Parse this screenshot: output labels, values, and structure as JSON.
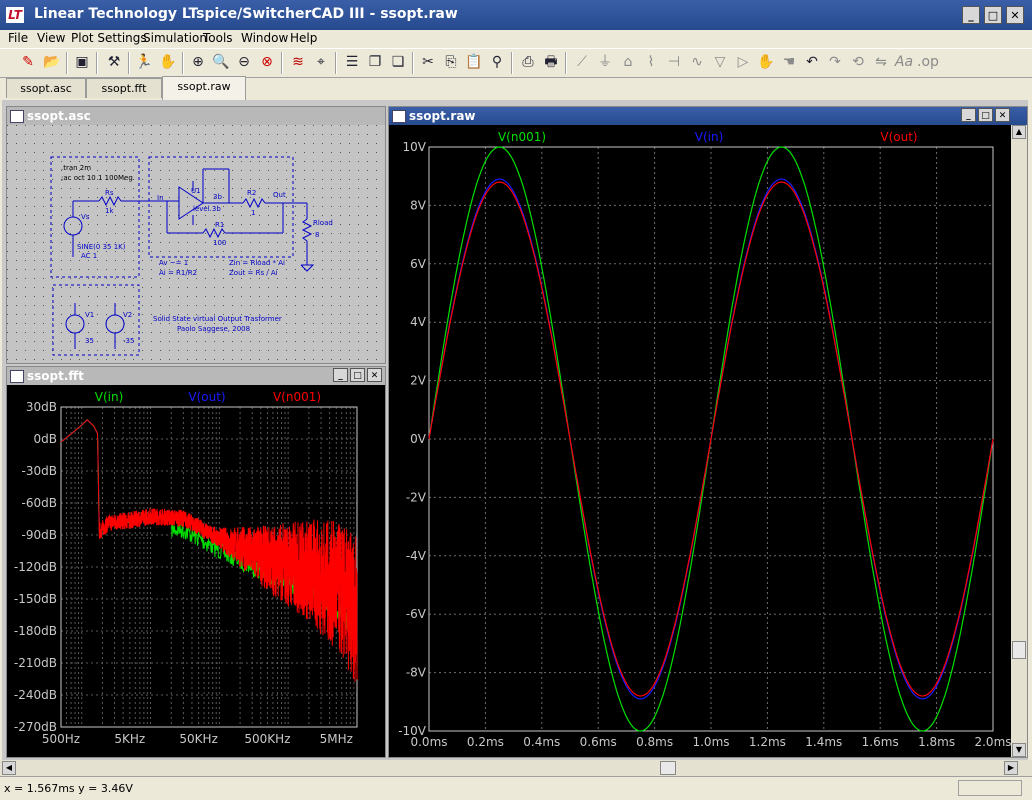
{
  "window": {
    "title": "Linear Technology LTspice/SwitcherCAD III - ssopt.raw",
    "icon_text": "LT"
  },
  "menu": [
    "File",
    "View",
    "Plot Settings",
    "Simulation",
    "Tools",
    "Window",
    "Help"
  ],
  "toolbar_icons": [
    "new-schematic-icon",
    "open-icon",
    "save-icon",
    "control-panel-icon",
    "run-icon",
    "pan-icon",
    "zoom-in-icon",
    "zoom-in-2-icon",
    "zoom-out-icon",
    "zoom-cancel-icon",
    "autoscale-icon",
    "cursor-icon",
    "tile-horizontal-icon",
    "cascade-icon",
    "tile-vertical-icon",
    "cut-icon",
    "copy-icon",
    "paste-icon",
    "find-icon",
    "print-setup-icon",
    "print-icon",
    "wire-icon",
    "ground-icon",
    "label-icon",
    "resistor-icon",
    "capacitor-icon",
    "inductor-icon",
    "diode-icon",
    "component-icon",
    "move-icon",
    "drag-icon",
    "undo-icon",
    "redo-icon",
    "rotate-icon",
    "mirror-icon",
    "text-icon",
    "spice-directive-icon"
  ],
  "tabs": [
    {
      "label": "ssopt.asc",
      "active": false
    },
    {
      "label": "ssopt.fft",
      "active": false
    },
    {
      "label": "ssopt.raw",
      "active": true
    }
  ],
  "schematic": {
    "title": "ssopt.asc",
    "directives": [
      ".tran 2m",
      ";ac oct 10 1 100Meg"
    ],
    "labels": {
      "rs": "Rs",
      "rs_val": "1k",
      "vs": "Vs",
      "sine": "SINE(0 35 1K)",
      "ac": "AC 1",
      "u1": "U1",
      "level": "level.3b",
      "u1_pin": "3b",
      "plus": "+",
      "minus": "-",
      "r2": "R2",
      "r2_val": "1",
      "out": "Out",
      "r1": "R1",
      "r1_val": "100",
      "rload": "Rload",
      "rload_val": "8",
      "in": "In",
      "av": "Av ~= 1",
      "ai": "Ai = R1/R2",
      "zin": "Zin = Rload * Ai",
      "zout": "Zout = Rs / Ai",
      "v1": "V1",
      "v1_val": "35",
      "v2": "V2",
      "v2_val": "-35",
      "caption": "Solid State virtual Output Trasformer",
      "author": "Paolo Saggese, 2008"
    }
  },
  "fft": {
    "title": "ssopt.fft",
    "chart_data": {
      "type": "line",
      "x_scale": "log",
      "x_ticks": [
        "500Hz",
        "5KHz",
        "50KHz",
        "500KHz",
        "5MHz"
      ],
      "y_ticks": [
        "30dB",
        "0dB",
        "-30dB",
        "-60dB",
        "-90dB",
        "-120dB",
        "-150dB",
        "-180dB",
        "-210dB",
        "-240dB",
        "-270dB"
      ],
      "ylim": [
        -270,
        30
      ],
      "xlim": [
        500,
        10000000
      ],
      "series": [
        {
          "name": "V(in)",
          "color": "#00e000"
        },
        {
          "name": "V(out)",
          "color": "#1a1aff"
        },
        {
          "name": "V(n001)",
          "color": "#ff0000"
        }
      ],
      "envelope": [
        [
          500,
          -3
        ],
        [
          1000,
          13
        ],
        [
          1200,
          18
        ],
        [
          1500,
          12
        ],
        [
          1700,
          5
        ],
        [
          1800,
          -88
        ],
        [
          2500,
          -80
        ],
        [
          5000,
          -78
        ],
        [
          10000,
          -74
        ],
        [
          30000,
          -76
        ],
        [
          100000,
          -95
        ],
        [
          500000,
          -118
        ],
        [
          2000000,
          -133
        ],
        [
          5000000,
          -150
        ],
        [
          10000000,
          -175
        ]
      ],
      "blue_tail": [
        [
          200000,
          -110
        ],
        [
          500000,
          -116
        ],
        [
          1000000,
          -119
        ],
        [
          3000000,
          -128
        ],
        [
          10000000,
          -143
        ]
      ],
      "background": "#000000",
      "grid": true
    }
  },
  "raw": {
    "title": "ssopt.raw",
    "chart_data": {
      "type": "line",
      "x_ticks": [
        "0.0ms",
        "0.2ms",
        "0.4ms",
        "0.6ms",
        "0.8ms",
        "1.0ms",
        "1.2ms",
        "1.4ms",
        "1.6ms",
        "1.8ms",
        "2.0ms"
      ],
      "y_ticks": [
        "10V",
        "8V",
        "6V",
        "4V",
        "2V",
        "0V",
        "-2V",
        "-4V",
        "-6V",
        "-8V",
        "-10V"
      ],
      "xlim": [
        0,
        2.0
      ],
      "ylim": [
        -10,
        10
      ],
      "x_unit": "ms",
      "frequency_khz": 1,
      "series": [
        {
          "name": "V(n001)",
          "color": "#00e000",
          "amplitude": 10
        },
        {
          "name": "V(in)",
          "color": "#1a1aff",
          "amplitude": 8.9
        },
        {
          "name": "V(out)",
          "color": "#ff0000",
          "amplitude": 8.8
        }
      ],
      "background": "#000000",
      "grid": true
    }
  },
  "status": {
    "text": "x = 1.567ms   y = 3.46V"
  }
}
